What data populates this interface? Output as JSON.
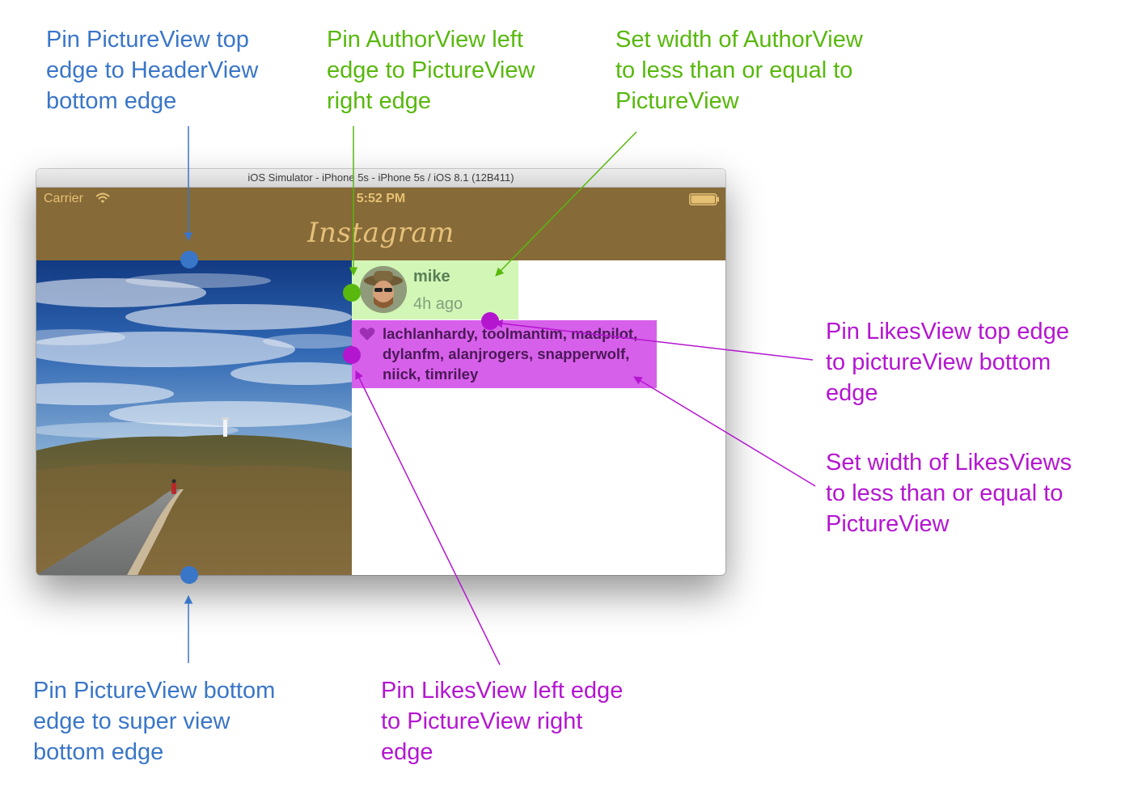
{
  "annotations": {
    "picture_top": "Pin PictureView top\nedge to HeaderView\nbottom edge",
    "author_left": "Pin AuthorView left\nedge to PictureView\nright edge",
    "author_width": "Set width of AuthorView\nto less than or equal to\nPictureView",
    "likes_top": "Pin LikesView top edge\nto pictureView bottom\nedge",
    "likes_width": "Set width of LikesViews\nto less than or equal to\nPictureView",
    "picture_bottom": "Pin PictureView bottom\nedge to super view\nbottom edge",
    "likes_left": "Pin LikesView left edge\nto PictureView right\nedge"
  },
  "window": {
    "title": "iOS Simulator - iPhone 5s - iPhone 5s / iOS 8.1 (12B411)"
  },
  "status_bar": {
    "carrier": "Carrier",
    "time": "5:52 PM",
    "wifi_icon": "wifi-icon",
    "battery_icon": "battery-icon"
  },
  "header": {
    "logo": "Instagram"
  },
  "author": {
    "name": "mike",
    "time_ago": "4h ago",
    "avatar_icon": "avatar"
  },
  "likes": {
    "heart_icon": "heart-icon",
    "text": "lachlanhardy, toolmantim, madpilot, dylanfm, alanjrogers, snapperwolf, niick, timriley"
  },
  "colors": {
    "blue": "#3a76c8",
    "green": "#58b80d",
    "purple": "#b416d0",
    "header": "#866a38",
    "author_view": "#d2f6b6",
    "likes_view": "#d760ea"
  }
}
